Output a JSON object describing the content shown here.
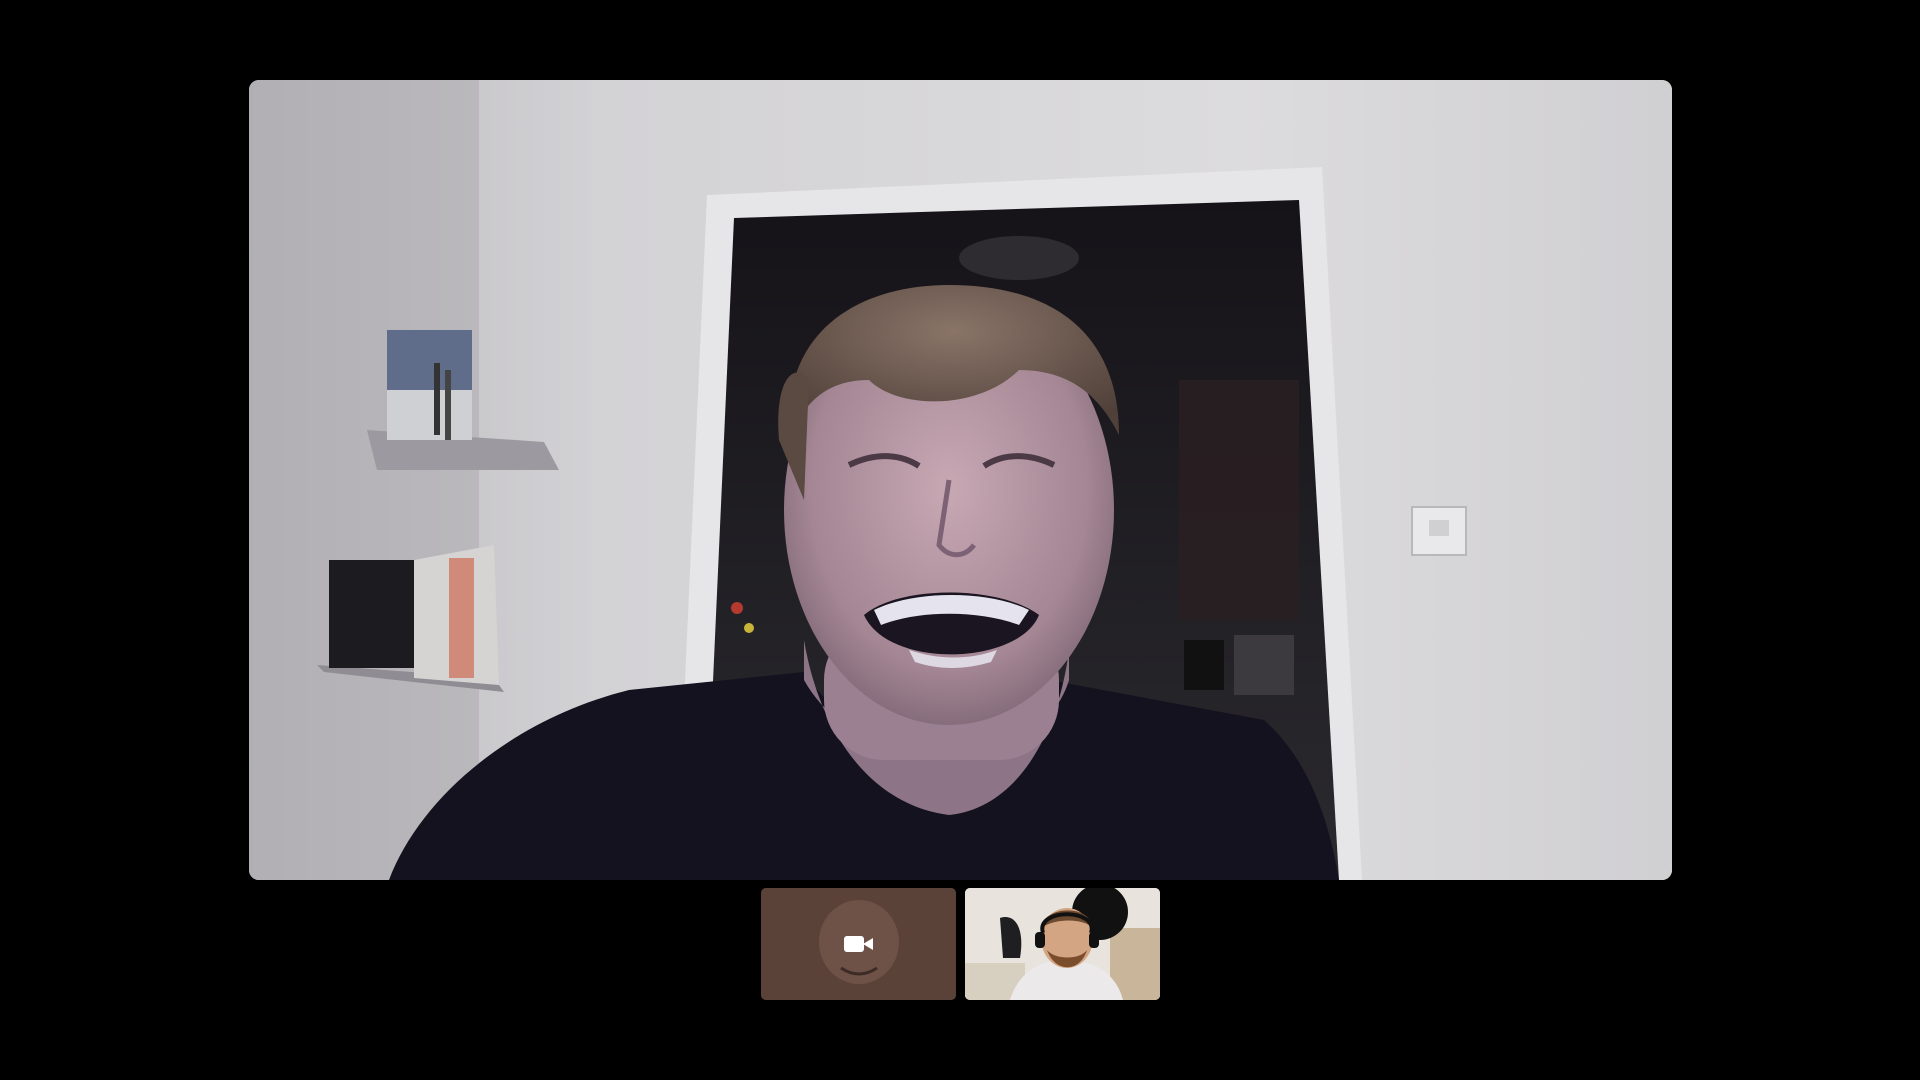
{
  "call": {
    "main_participant": {
      "label": "",
      "video_state": "on"
    },
    "thumbnails": [
      {
        "label": "",
        "video_state": "off",
        "icon": "camera-off-icon",
        "tile_color": "#5a4239"
      },
      {
        "label": "",
        "video_state": "on",
        "icon": "",
        "tile_color": "#e9e5df"
      }
    ]
  },
  "colors": {
    "background": "#000000",
    "self_tile": "#5a4239"
  }
}
